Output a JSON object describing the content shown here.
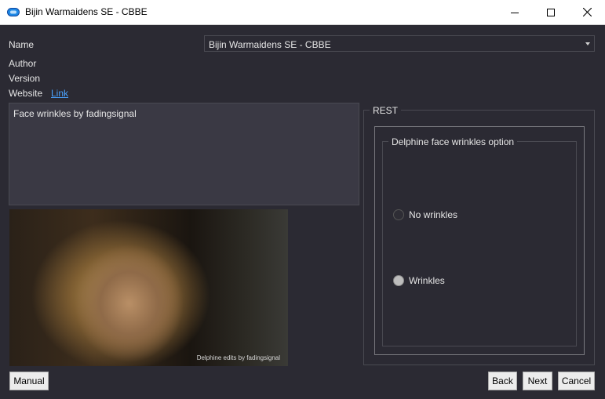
{
  "window": {
    "title": "Bijin Warmaidens SE - CBBE",
    "app_icon": "link-chain-icon",
    "controls": [
      "minimize-icon",
      "maximize-icon",
      "close-icon"
    ]
  },
  "info": {
    "name_label": "Name",
    "name_value": "Bijin Warmaidens SE - CBBE",
    "author_label": "Author",
    "version_label": "Version",
    "website_label": "Website",
    "website_link": "Link"
  },
  "description": "Face wrinkles by fadingsignal",
  "preview": {
    "caption": "Delphine edits by fadingsignal"
  },
  "rest_group": {
    "title": "REST",
    "option_group": {
      "title": "Delphine face wrinkles option",
      "options": [
        {
          "label": "No wrinkles",
          "selected": false
        },
        {
          "label": "Wrinkles",
          "selected": true
        }
      ]
    }
  },
  "buttons": {
    "manual": "Manual",
    "back": "Back",
    "next": "Next",
    "cancel": "Cancel"
  },
  "colors": {
    "background": "#2b2a33",
    "link": "#4aa3ff",
    "title_bar": "#ffffff",
    "icon_blue": "#1e88e5"
  }
}
